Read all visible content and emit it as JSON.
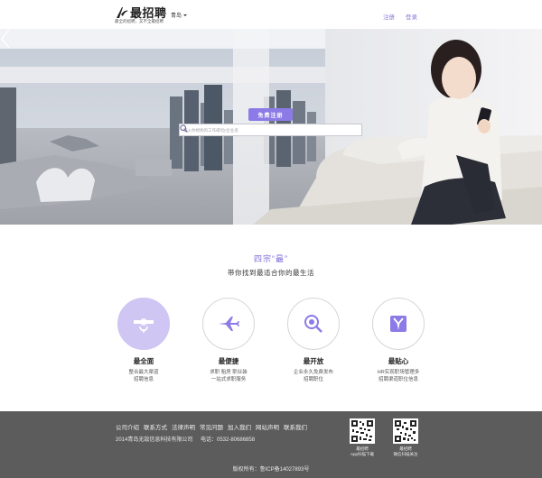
{
  "header": {
    "logo_text": "最招聘",
    "tagline": "最全的招聘，又不全最招聘",
    "city": "青岛",
    "register": "注册",
    "login": "登录"
  },
  "hero": {
    "register_button": "免费注册",
    "search_placeholder": "输入你想找的工作/职位/企业名"
  },
  "features": {
    "title": "四宗“最”",
    "subtitle": "带你找到最适合你的最生活",
    "items": [
      {
        "icon": "satellite-icon",
        "name": "最全面",
        "desc1": "整合最大渠道",
        "desc2": "招聘信息"
      },
      {
        "icon": "airplane-icon",
        "name": "最便捷",
        "desc1": "求职 租房 职业装",
        "desc2": "一站式求职服务"
      },
      {
        "icon": "magnifier-icon",
        "name": "最开放",
        "desc1": "企业永久免费发布",
        "desc2": "招聘职位"
      },
      {
        "icon": "suit-icon",
        "name": "最贴心",
        "desc1": "HR实现职场管理多",
        "desc2": "招聘渠道职位信息"
      }
    ]
  },
  "footer": {
    "links": [
      "公司介绍",
      "联系方式",
      "法律声明",
      "常见问题",
      "加入我们",
      "网站声明",
      "联系我们"
    ],
    "company": "2014青岛无敌信息科技有限公司",
    "phone": "电话：0532-80686858",
    "qr1_title": "最招聘",
    "qr1_sub": "App扫描下载",
    "qr2_title": "最招聘",
    "qr2_sub": "微信扫描关注",
    "copyright": "版权所有：鲁ICP备14027893号"
  },
  "colors": {
    "accent": "#8c7ae6",
    "accent_light": "#cfc6f3",
    "footer_bg": "#5c5c5c"
  }
}
